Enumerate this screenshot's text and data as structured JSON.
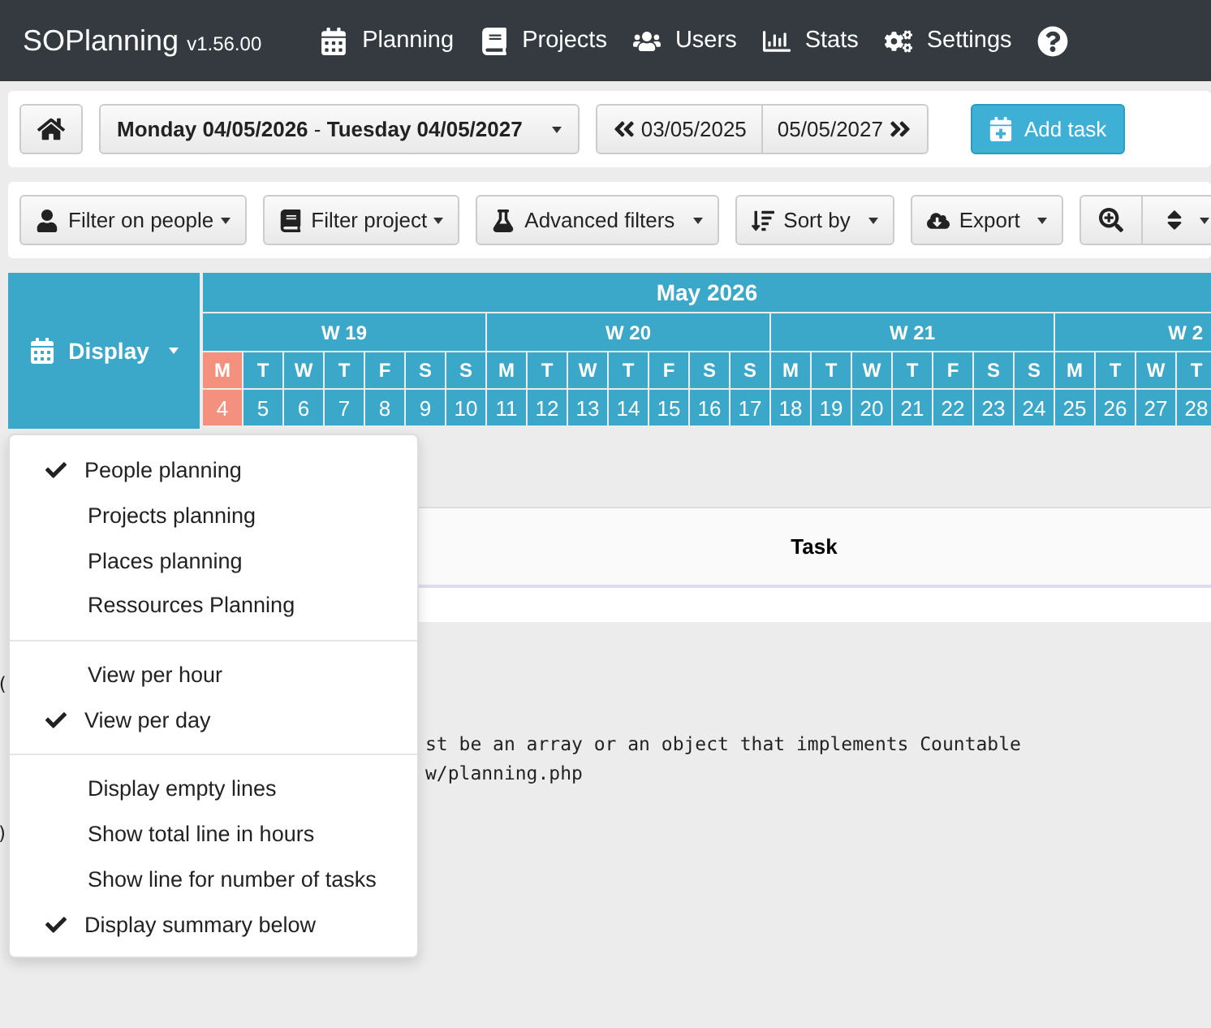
{
  "navbar": {
    "brand": "SOPlanning",
    "version": "v1.56.00",
    "items": [
      {
        "label": "Planning"
      },
      {
        "label": "Projects"
      },
      {
        "label": "Users"
      },
      {
        "label": "Stats"
      },
      {
        "label": "Settings"
      }
    ]
  },
  "toolbar": {
    "date_range": {
      "start": "Monday 04/05/2026",
      "separator": "-",
      "end": "Tuesday 04/05/2027"
    },
    "previous": "03/05/2025",
    "next": "05/05/2027",
    "add_task": "Add task"
  },
  "filters": [
    {
      "label": "Filter on people"
    },
    {
      "label": "Filter project"
    },
    {
      "label": "Advanced filters"
    },
    {
      "label": "Sort by"
    },
    {
      "label": "Export"
    }
  ],
  "calendar": {
    "display_button": "Display",
    "month": "May 2026",
    "weeks": [
      {
        "label": "W 19",
        "days": [
          {
            "letter": "M",
            "number": "4",
            "today": true
          },
          {
            "letter": "T",
            "number": "5",
            "today": false
          },
          {
            "letter": "W",
            "number": "6",
            "today": false
          },
          {
            "letter": "T",
            "number": "7",
            "today": false
          },
          {
            "letter": "F",
            "number": "8",
            "today": false
          },
          {
            "letter": "S",
            "number": "9",
            "today": false
          },
          {
            "letter": "S",
            "number": "10",
            "today": false
          }
        ]
      },
      {
        "label": "W 20",
        "days": [
          {
            "letter": "M",
            "number": "11",
            "today": false
          },
          {
            "letter": "T",
            "number": "12",
            "today": false
          },
          {
            "letter": "W",
            "number": "13",
            "today": false
          },
          {
            "letter": "T",
            "number": "14",
            "today": false
          },
          {
            "letter": "F",
            "number": "15",
            "today": false
          },
          {
            "letter": "S",
            "number": "16",
            "today": false
          },
          {
            "letter": "S",
            "number": "17",
            "today": false
          }
        ]
      },
      {
        "label": "W 21",
        "days": [
          {
            "letter": "M",
            "number": "18",
            "today": false
          },
          {
            "letter": "T",
            "number": "19",
            "today": false
          },
          {
            "letter": "W",
            "number": "20",
            "today": false
          },
          {
            "letter": "T",
            "number": "21",
            "today": false
          },
          {
            "letter": "F",
            "number": "22",
            "today": false
          },
          {
            "letter": "S",
            "number": "23",
            "today": false
          },
          {
            "letter": "S",
            "number": "24",
            "today": false
          }
        ]
      },
      {
        "label": "W 2",
        "days": [
          {
            "letter": "M",
            "number": "25",
            "today": false
          },
          {
            "letter": "T",
            "number": "26",
            "today": false
          },
          {
            "letter": "W",
            "number": "27",
            "today": false
          },
          {
            "letter": "T",
            "number": "28",
            "today": false
          }
        ]
      }
    ]
  },
  "table": {
    "columns": [
      "Task"
    ]
  },
  "error_lines": [
    {
      "kind": "blank"
    },
    {
      "kind": "edge",
      "text": "("
    },
    {
      "kind": "blank"
    },
    {
      "kind": "behind",
      "text": "st be an array or an object that implements Countable"
    },
    {
      "kind": "behind",
      "text": "w/planning.php"
    },
    {
      "kind": "blank"
    },
    {
      "kind": "edge",
      "text": ")"
    }
  ],
  "display_menu": {
    "sections": [
      [
        {
          "label": "People planning",
          "checked": true
        },
        {
          "label": "Projects planning",
          "checked": false
        },
        {
          "label": "Places planning",
          "checked": false
        },
        {
          "label": "Ressources Planning",
          "checked": false
        }
      ],
      [
        {
          "label": "View per hour",
          "checked": false
        },
        {
          "label": "View per day",
          "checked": true
        }
      ],
      [
        {
          "label": "Display empty lines",
          "checked": false
        },
        {
          "label": "Show total line in hours",
          "checked": false
        },
        {
          "label": "Show line for number of tasks",
          "checked": false
        },
        {
          "label": "Display summary below",
          "checked": true
        }
      ]
    ]
  }
}
